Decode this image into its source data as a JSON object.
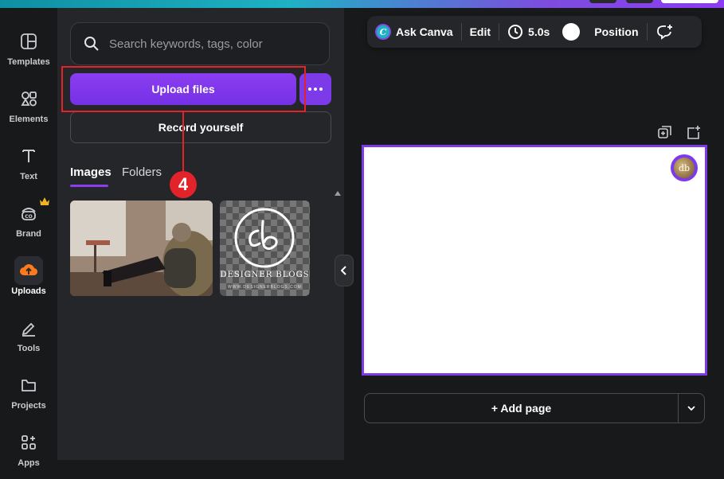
{
  "rail": {
    "items": [
      {
        "label": "Templates",
        "icon": "templates-icon"
      },
      {
        "label": "Elements",
        "icon": "elements-icon"
      },
      {
        "label": "Text",
        "icon": "text-icon"
      },
      {
        "label": "Brand",
        "icon": "brand-icon"
      },
      {
        "label": "Uploads",
        "icon": "uploads-icon"
      },
      {
        "label": "Tools",
        "icon": "tools-icon"
      },
      {
        "label": "Projects",
        "icon": "projects-icon"
      },
      {
        "label": "Apps",
        "icon": "apps-icon"
      }
    ],
    "active": "Uploads"
  },
  "panel": {
    "search_placeholder": "Search keywords, tags, color",
    "upload_label": "Upload files",
    "record_label": "Record yourself",
    "step_number": "4",
    "tabs": [
      {
        "label": "Images",
        "active": true
      },
      {
        "label": "Folders",
        "active": false
      }
    ],
    "thumbs": [
      {
        "name": "photo-thumbnail"
      },
      {
        "name": "designer-blogs-logo",
        "logo_text": "DESIGNER BLOGS",
        "logo_sub": "WWW.DESIGNERBLOGS.COM"
      }
    ]
  },
  "toolbar": {
    "ask_label": "Ask Canva",
    "edit_label": "Edit",
    "duration": "5.0s",
    "position_label": "Position"
  },
  "editor": {
    "add_page_label": "+ Add page",
    "avatar_initials": "db"
  },
  "colors": {
    "accent": "#8b3df0",
    "highlight": "#e2242a",
    "bg": "#18191b",
    "panel": "#252629"
  }
}
